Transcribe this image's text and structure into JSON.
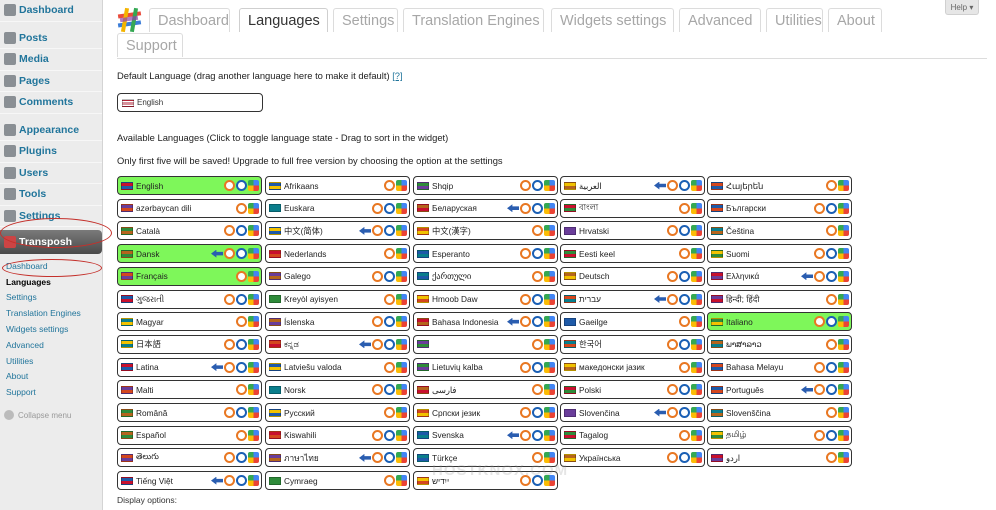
{
  "sidebar": {
    "items": [
      {
        "label": "Dashboard",
        "icon": "dashboard-icon"
      },
      {
        "label": "Posts",
        "icon": "posts-icon"
      },
      {
        "label": "Media",
        "icon": "media-icon"
      },
      {
        "label": "Pages",
        "icon": "pages-icon"
      },
      {
        "label": "Comments",
        "icon": "comments-icon"
      },
      {
        "label": "Appearance",
        "icon": "appearance-icon"
      },
      {
        "label": "Plugins",
        "icon": "plugins-icon"
      },
      {
        "label": "Users",
        "icon": "users-icon"
      },
      {
        "label": "Tools",
        "icon": "tools-icon"
      },
      {
        "label": "Settings",
        "icon": "settings-icon"
      }
    ],
    "active": {
      "label": "Transposh",
      "icon": "transposh-icon"
    },
    "submenu": [
      "Dashboard",
      "Languages",
      "Settings",
      "Translation Engines",
      "Widgets settings",
      "Advanced",
      "Utilities",
      "About",
      "Support"
    ],
    "current_sub": "Languages",
    "collapse": "Collapse menu"
  },
  "help": "Help ▾",
  "tabs": [
    "Dashboard",
    "Languages",
    "Settings",
    "Translation Engines",
    "Widgets settings",
    "Advanced",
    "Utilities",
    "About",
    "Support"
  ],
  "active_tab": "Languages",
  "default_heading": "Default Language (drag another language here to make it default)",
  "default_help": "[?]",
  "default_language": "English",
  "available_heading": "Available Languages (Click to toggle language state - Drag to sort in the widget)",
  "notice": "Only first five will be saved! Upgrade to full free version by choosing the option at the settings",
  "display_options": "Display options:",
  "watermark": "HOSTKNOX.COM",
  "colors": {
    "active_language_bg": "#7ef75a",
    "link": "#21759b",
    "sidebar_active": "#4a4a4a"
  },
  "languages": [
    [
      "English",
      "Afrikaans",
      "Shqip",
      "العربية",
      "Հայերեն"
    ],
    [
      "azərbaycan dili",
      "Euskara",
      "Беларуская",
      "বাংলা",
      "Български"
    ],
    [
      "Català",
      "中文(简体)",
      "中文(漢字)",
      "Hrvatski",
      "Čeština"
    ],
    [
      "Dansk",
      "Nederlands",
      "Esperanto",
      "Eesti keel",
      "Suomi"
    ],
    [
      "Français",
      "Galego",
      "ქართული",
      "Deutsch",
      "Ελληνικά"
    ],
    [
      "ગુજરાતી",
      "Kreyòl ayisyen",
      "Hmoob Daw",
      "עברית",
      "हिन्दी; हिंदी"
    ],
    [
      "Magyar",
      "Íslenska",
      "Bahasa Indonesia",
      "Gaeilge",
      "Italiano"
    ],
    [
      "日本語",
      "ಕನ್ನಡ",
      "",
      "한국어",
      "ພາສາລາວ"
    ],
    [
      "Latina",
      "Latviešu valoda",
      "Lietuvių kalba",
      "македонски јазик",
      "Bahasa Melayu"
    ],
    [
      "Malti",
      "Norsk",
      "فارسی",
      "Polski",
      "Português"
    ],
    [
      "Română",
      "Русский",
      "Српски језик",
      "Slovenčina",
      "Slovenščina"
    ],
    [
      "Español",
      "Kiswahili",
      "Svenska",
      "Tagalog",
      "தமிழ்"
    ],
    [
      "తెలుగు",
      "ภาษาไทย",
      "Türkçe",
      "Українська",
      "اردو"
    ],
    [
      "Tiếng Việt",
      "Cymraeg",
      "ייִדיש",
      "",
      ""
    ]
  ],
  "active_languages": [
    "English",
    "Dansk",
    "Français",
    "Italiano"
  ]
}
